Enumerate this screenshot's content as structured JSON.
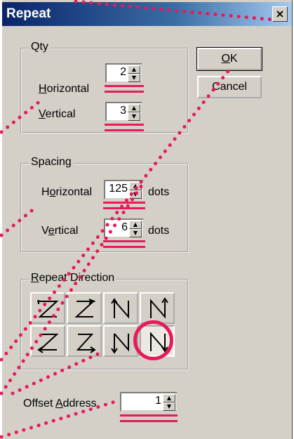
{
  "window": {
    "title": "Repeat",
    "close_glyph": "×"
  },
  "qty": {
    "group_label": "Qty",
    "horizontal": {
      "label_u": "H",
      "label_rest": "orizontal",
      "value": "2"
    },
    "vertical": {
      "label_u": "V",
      "label_rest": "ertical",
      "value": "3"
    }
  },
  "spacing": {
    "group_label": "Spacing",
    "horizontal": {
      "label_pre": "H",
      "label_u": "o",
      "label_rest": "rizontal",
      "value": "125",
      "unit": "dots"
    },
    "vertical": {
      "label_pre": "V",
      "label_u": "e",
      "label_rest": "rtical",
      "value": "6",
      "unit": "dots"
    }
  },
  "repeat_direction": {
    "label_u": "R",
    "label_rest": "epeat Direction",
    "buttons": [
      "z-left-right-down",
      "z-right-left-down",
      "n-up-right",
      "n-down-right",
      "z-left-up",
      "z-right-up",
      "n-up-left",
      "n-down-left-selected"
    ]
  },
  "offset": {
    "label_pre": "Offset ",
    "label_u": "A",
    "label_rest": "ddress",
    "value": "1"
  },
  "buttons": {
    "ok": "OK",
    "ok_u": "O",
    "ok_rest": "K",
    "cancel": "Cancel"
  },
  "annotation": {
    "highlight_color": "#e8195c"
  }
}
